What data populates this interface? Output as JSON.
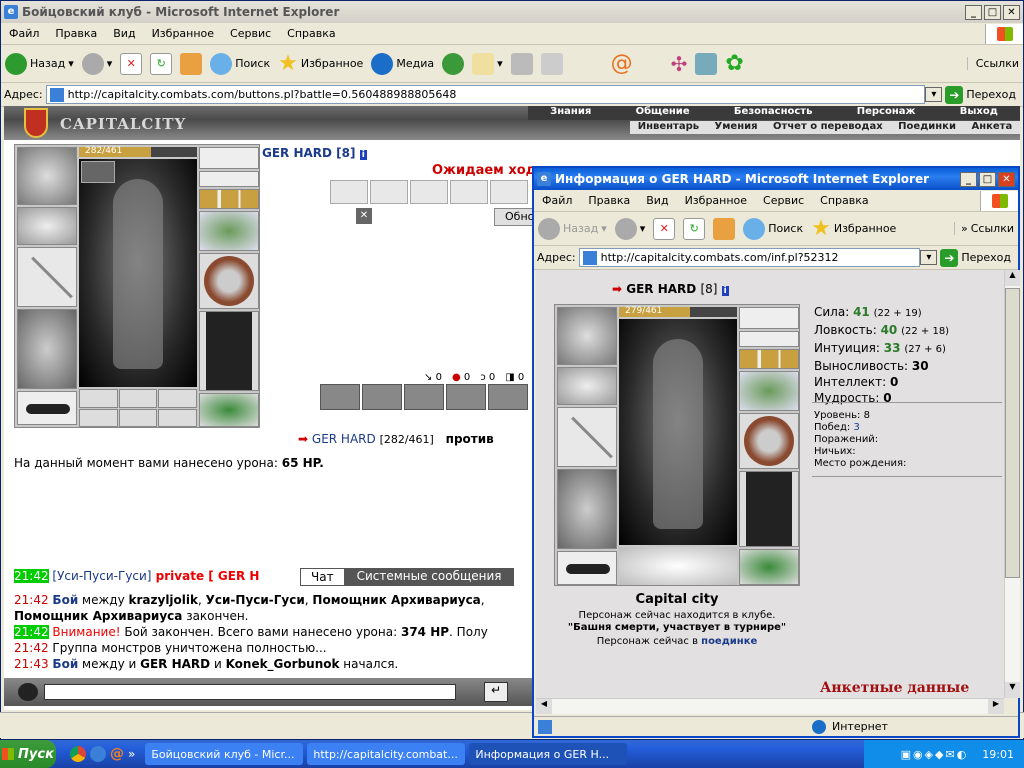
{
  "main_window": {
    "title": "Бойцовский клуб - Microsoft Internet Explorer",
    "menu": [
      "Файл",
      "Правка",
      "Вид",
      "Избранное",
      "Сервис",
      "Справка"
    ],
    "toolbar": {
      "back": "Назад",
      "search": "Поиск",
      "favorites": "Избранное",
      "media": "Медиа",
      "links": "Ссылки"
    },
    "address_label": "Адрес:",
    "address_url": "http://capitalcity.combats.com/buttons.pl?battle=0.560488988805648",
    "go_label": "Переход"
  },
  "game": {
    "logo": "CAPITALCITY",
    "nav_top": [
      "Знания",
      "Общение",
      "Безопасность",
      "Персонаж",
      "Выход"
    ],
    "nav_bottom": [
      "Инвентарь",
      "Умения",
      "Отчет о переводах",
      "Поединки",
      "Анкета"
    ],
    "hp_bar": "282/461",
    "player_name": "GER HARD [8]",
    "waiting_text": "Ожидаем хода",
    "refresh_label": "Обно",
    "counters": [
      "0",
      "0",
      "0",
      "0"
    ],
    "vs_name": "GER HARD",
    "vs_hp": "[282/461]",
    "vs_word": "против",
    "damage_text": "На данный момент вами нанесено урона:",
    "damage_value": "65 HP."
  },
  "chat": {
    "tabs": [
      "Чат",
      "Системные сообщения"
    ],
    "lines": [
      {
        "time": "21:42",
        "time_bg": true,
        "parts": [
          "[Уси-Пуси-Гуси]",
          " private [ GER H"
        ]
      },
      {
        "time": "21:42",
        "time_bg": false,
        "parts": [
          "Бой",
          " между ",
          "krazyljolik",
          ", ",
          "Уси-Пуси-Гуси",
          ", ",
          "Помощник Архивариуса",
          ","
        ]
      },
      {
        "time": "",
        "time_bg": false,
        "parts": [
          "Помощник Архивариуса",
          " закончен."
        ]
      },
      {
        "time": "21:42",
        "time_bg": true,
        "parts": [
          "Внимание!",
          " Бой закончен. Всего вами нанесено урона: ",
          "374 HP",
          ". Полу"
        ]
      },
      {
        "time": "21:42",
        "time_bg": false,
        "parts": [
          "Группа монстров уничтожена полностью..."
        ]
      },
      {
        "time": "21:43",
        "time_bg": false,
        "parts": [
          "Бой",
          " между и ",
          "GER HARD",
          " и ",
          "Konek_Gorbunok",
          " начался."
        ]
      }
    ]
  },
  "popup": {
    "title": "Информация о GER HARD - Microsoft Internet Explorer",
    "menu": [
      "Файл",
      "Правка",
      "Вид",
      "Избранное",
      "Сервис",
      "Справка"
    ],
    "toolbar": {
      "back": "Назад",
      "search": "Поиск",
      "favorites": "Избранное",
      "links": "Ссылки"
    },
    "address_label": "Адрес:",
    "address_url": "http://capitalcity.combats.com/inf.pl?52312",
    "go_label": "Переход",
    "char_name": "GER HARD",
    "char_level": "[8]",
    "hp_bar": "279/461",
    "stats": [
      {
        "label": "Сила:",
        "value": "41",
        "extra": "(22 + 19)"
      },
      {
        "label": "Ловкость:",
        "value": "40",
        "extra": "(22 + 18)"
      },
      {
        "label": "Интуиция:",
        "value": "33",
        "extra": "(27 + 6)"
      },
      {
        "label": "Выносливость:",
        "value": "30",
        "extra": ""
      },
      {
        "label": "Интеллект:",
        "value": "0",
        "extra": ""
      },
      {
        "label": "Мудрость:",
        "value": "0",
        "extra": ""
      }
    ],
    "level_label": "Уровень:",
    "level_value": "8",
    "wins_label": "Побед:",
    "wins_value": "3",
    "losses_label": "Поражений:",
    "draws_label": "Ничьих:",
    "birthplace_label": "Место рождения:",
    "city": "Capital city",
    "location_text": "Персонаж сейчас находится в клубе.",
    "location_room": "\"Башня смерти, участвует в турнире\"",
    "battle_prefix": "Персонаж сейчас в",
    "battle_link": "поединке",
    "cut_text": "Анкетные данные",
    "status_zone": "Интернет"
  },
  "taskbar": {
    "start": "Пуск",
    "tasks": [
      "Бойцовский клуб - Micr...",
      "http://capitalcity.combat...",
      "Информация о GER H..."
    ],
    "clock": "19:01"
  }
}
